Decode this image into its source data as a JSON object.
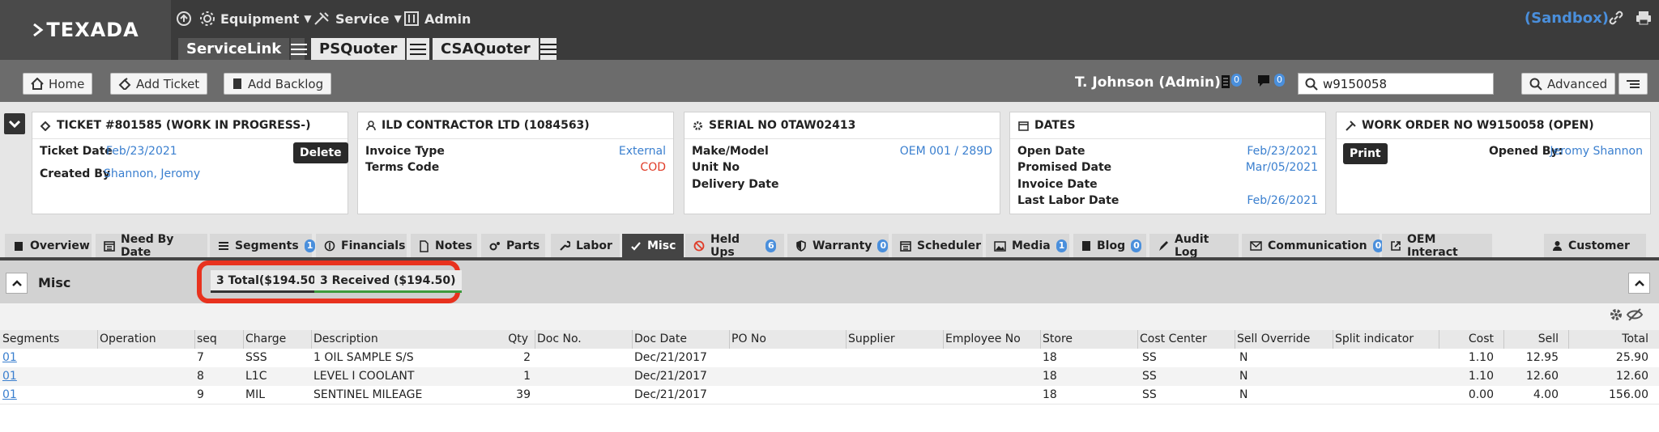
{
  "brand": {
    "logo_text": "TEXADA"
  },
  "topnav": {
    "equipment": "Equipment",
    "service": "Service",
    "admin": "Admin",
    "sandbox": "(Sandbox)"
  },
  "product_tabs": [
    {
      "label": "ServiceLink"
    },
    {
      "label": "PSQuoter"
    },
    {
      "label": "CSAQuoter"
    }
  ],
  "toolbar": {
    "home": "Home",
    "add_ticket": "Add Ticket",
    "add_backlog": "Add Backlog",
    "user": "T. Johnson (Admin)",
    "badge1": "0",
    "badge2": "0",
    "search_value": "w9150058",
    "advanced": "Advanced"
  },
  "cards": {
    "ticket": {
      "title": "TICKET #801585 (WORK IN PROGRESS-)",
      "ticket_date_label": "Ticket Date",
      "ticket_date": "Feb/23/2021",
      "created_by_label": "Created By",
      "created_by": "Shannon, Jeromy",
      "delete": "Delete"
    },
    "customer": {
      "title": "ILD CONTRACTOR LTD (1084563)",
      "invoice_type_label": "Invoice Type",
      "invoice_type": "External",
      "terms_code_label": "Terms Code",
      "terms_code": "COD"
    },
    "serial": {
      "title": "SERIAL NO 0TAW02413",
      "make_model_label": "Make/Model",
      "make_model": "OEM 001 / 289D",
      "unit_no_label": "Unit No",
      "delivery_date_label": "Delivery Date"
    },
    "dates": {
      "title": "DATES",
      "open_date_label": "Open Date",
      "open_date": "Feb/23/2021",
      "promised_date_label": "Promised Date",
      "promised_date": "Mar/05/2021",
      "invoice_date_label": "Invoice Date",
      "last_labor_date_label": "Last Labor Date",
      "last_labor_date": "Feb/26/2021"
    },
    "work_order": {
      "title": "WORK ORDER NO W9150058 (OPEN)",
      "print": "Print",
      "opened_by_label": "Opened By:",
      "opened_by": "Jeromy Shannon"
    }
  },
  "tabs": [
    {
      "label": "Overview"
    },
    {
      "label": "Need By Date"
    },
    {
      "label": "Segments",
      "badge": "1"
    },
    {
      "label": "Financials"
    },
    {
      "label": "Notes"
    },
    {
      "label": "Parts"
    },
    {
      "label": "Labor"
    },
    {
      "label": "Misc"
    },
    {
      "label": "Held Ups",
      "badge": "6"
    },
    {
      "label": "Warranty",
      "badge": "0"
    },
    {
      "label": "Scheduler"
    },
    {
      "label": "Media",
      "badge": "1"
    },
    {
      "label": "Blog",
      "badge": "0"
    },
    {
      "label": "Audit Log"
    },
    {
      "label": "Communication",
      "badge": "0"
    },
    {
      "label": "OEM Interact"
    },
    {
      "label": "Customer"
    }
  ],
  "misc": {
    "title": "Misc",
    "total": "3 Total($194.50)",
    "received": "3 Received ($194.50)"
  },
  "table": {
    "columns": [
      "Segments",
      "Operation",
      "seq",
      "Charge",
      "Description",
      "Qty",
      "Doc No.",
      "Doc Date",
      "PO No",
      "Supplier",
      "Employee No",
      "Store",
      "Cost Center",
      "Sell Override",
      "Split indicator",
      "Cost",
      "Sell",
      "Total"
    ],
    "rows": [
      {
        "segment": "01",
        "operation": "",
        "seq": "7",
        "charge": "SSS",
        "description": "1 OIL SAMPLE S/S",
        "qty": "2",
        "doc_no": "",
        "doc_date": "Dec/21/2017",
        "po_no": "",
        "supplier": "",
        "employee_no": "",
        "store": "18",
        "cost_center": "SS",
        "sell_override": "N",
        "split": "",
        "cost": "1.10",
        "sell": "12.95",
        "total": "25.90"
      },
      {
        "segment": "01",
        "operation": "",
        "seq": "8",
        "charge": "L1C",
        "description": "LEVEL I COOLANT",
        "qty": "1",
        "doc_no": "",
        "doc_date": "Dec/21/2017",
        "po_no": "",
        "supplier": "",
        "employee_no": "",
        "store": "18",
        "cost_center": "SS",
        "sell_override": "N",
        "split": "",
        "cost": "1.10",
        "sell": "12.60",
        "total": "12.60"
      },
      {
        "segment": "01",
        "operation": "",
        "seq": "9",
        "charge": "MIL",
        "description": "SENTINEL MILEAGE",
        "qty": "39",
        "doc_no": "",
        "doc_date": "Dec/21/2017",
        "po_no": "",
        "supplier": "",
        "employee_no": "",
        "store": "18",
        "cost_center": "SS",
        "sell_override": "N",
        "split": "",
        "cost": "0.00",
        "sell": "4.00",
        "total": "156.00"
      }
    ]
  }
}
